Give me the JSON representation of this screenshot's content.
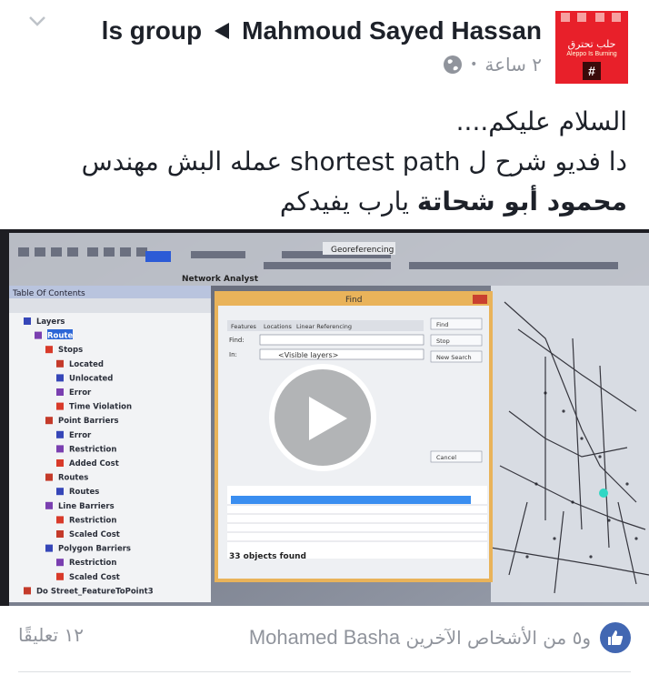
{
  "header": {
    "group_name": "ls group",
    "author": "Mahmoud Sayed Hassan",
    "time_ago": "٢ ساعة",
    "avatar_title": "حلب تحترق",
    "avatar_sub": "Aleppo Is Burning",
    "avatar_hash": "#"
  },
  "post": {
    "line1": "السلام عليكم....",
    "line2": "دا فديو شرح ل shortest path عمله البش مهندس",
    "line3_bold": "محمود أبو شحاتة",
    "line3_rest": " يارب يفيدكم"
  },
  "video": {
    "toolbar_label": "Georeferencing",
    "network_analyst": "Network Analyst",
    "toc_title": "Table Of Contents",
    "toc_items": [
      "Layers",
      "Route",
      "Stops",
      "Located",
      "Unlocated",
      "Error",
      "Time Violation",
      "Point Barriers",
      "Error",
      "Restriction",
      "Added Cost",
      "Routes",
      "Routes",
      "Line Barriers",
      "Restriction",
      "Scaled Cost",
      "Polygon Barriers",
      "Restriction",
      "Scaled Cost",
      "Do Street_FeatureToPoint3"
    ],
    "find_title": "Find",
    "find_tabs": [
      "Features",
      "Locations",
      "Linear Referencing"
    ],
    "find_label": "Find:",
    "in_label": "In:",
    "in_value": "<Visible layers>",
    "find_buttons": [
      "Find",
      "Stop",
      "New Search",
      "Cancel"
    ],
    "objects_found": "33 objects found"
  },
  "footer": {
    "reactions_text": "و٥ من الأشخاص الآخرين",
    "reactor_name": "Mohamed Basha",
    "comments": "١٢ تعليقًا"
  }
}
